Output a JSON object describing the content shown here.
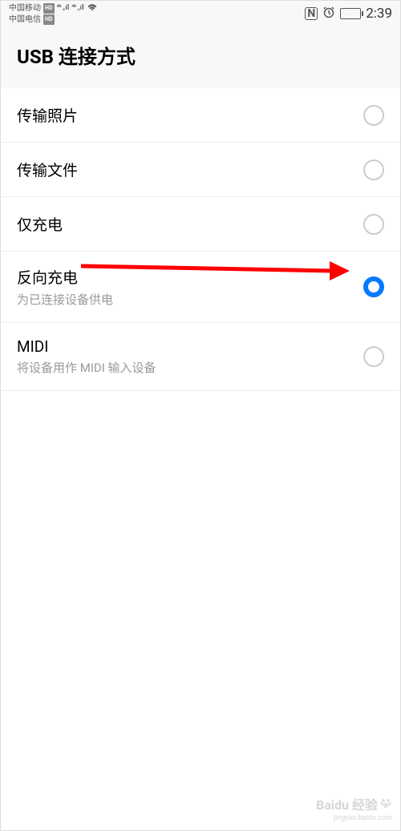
{
  "statusbar": {
    "carrier1": "中国移动",
    "carrier2": "中国电信",
    "hd_badge": "HD",
    "signal_4g": "4G",
    "time": "2:39"
  },
  "header": {
    "title": "USB 连接方式"
  },
  "options": [
    {
      "title": "传输照片",
      "subtitle": "",
      "selected": false
    },
    {
      "title": "传输文件",
      "subtitle": "",
      "selected": false
    },
    {
      "title": "仅充电",
      "subtitle": "",
      "selected": false
    },
    {
      "title": "反向充电",
      "subtitle": "为已连接设备供电",
      "selected": true
    },
    {
      "title": "MIDI",
      "subtitle": "将设备用作 MIDI 输入设备",
      "selected": false
    }
  ],
  "watermark": {
    "brand": "Baidu 经验",
    "sub": "jingyan.baidu.com"
  },
  "annotation": {
    "arrow_color": "#ff0000"
  }
}
